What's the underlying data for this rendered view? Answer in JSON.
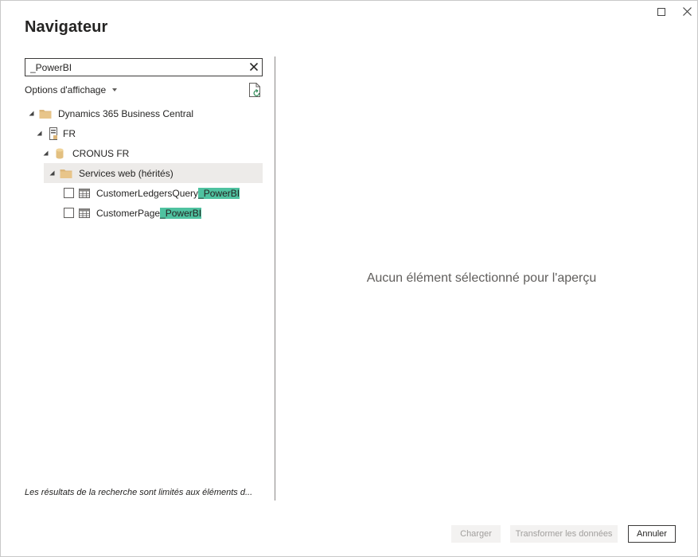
{
  "dialog": {
    "title": "Navigateur"
  },
  "search": {
    "value": "_PowerBI"
  },
  "display_options": {
    "label": "Options d'affichage"
  },
  "tree": {
    "root": {
      "label": "Dynamics 365 Business Central"
    },
    "environment": {
      "label": "FR"
    },
    "company": {
      "label": "CRONUS FR"
    },
    "folder": {
      "label": "Services web (hérités)"
    },
    "items": [
      {
        "label_prefix": "CustomerLedgersQuery",
        "label_match": "_PowerBI",
        "checked": false
      },
      {
        "label_prefix": "CustomerPage",
        "label_match": "_PowerBI",
        "checked": false
      }
    ]
  },
  "preview": {
    "empty_message": "Aucun élément sélectionné pour l'aperçu"
  },
  "footnote": {
    "text": "Les résultats de la recherche sont limités aux éléments d..."
  },
  "buttons": {
    "load": "Charger",
    "transform": "Transformer les données",
    "cancel": "Annuler"
  },
  "colors": {
    "search_highlight": "#4fc2a0",
    "selected_row": "#edebe9",
    "folder": "#dcb67a"
  }
}
